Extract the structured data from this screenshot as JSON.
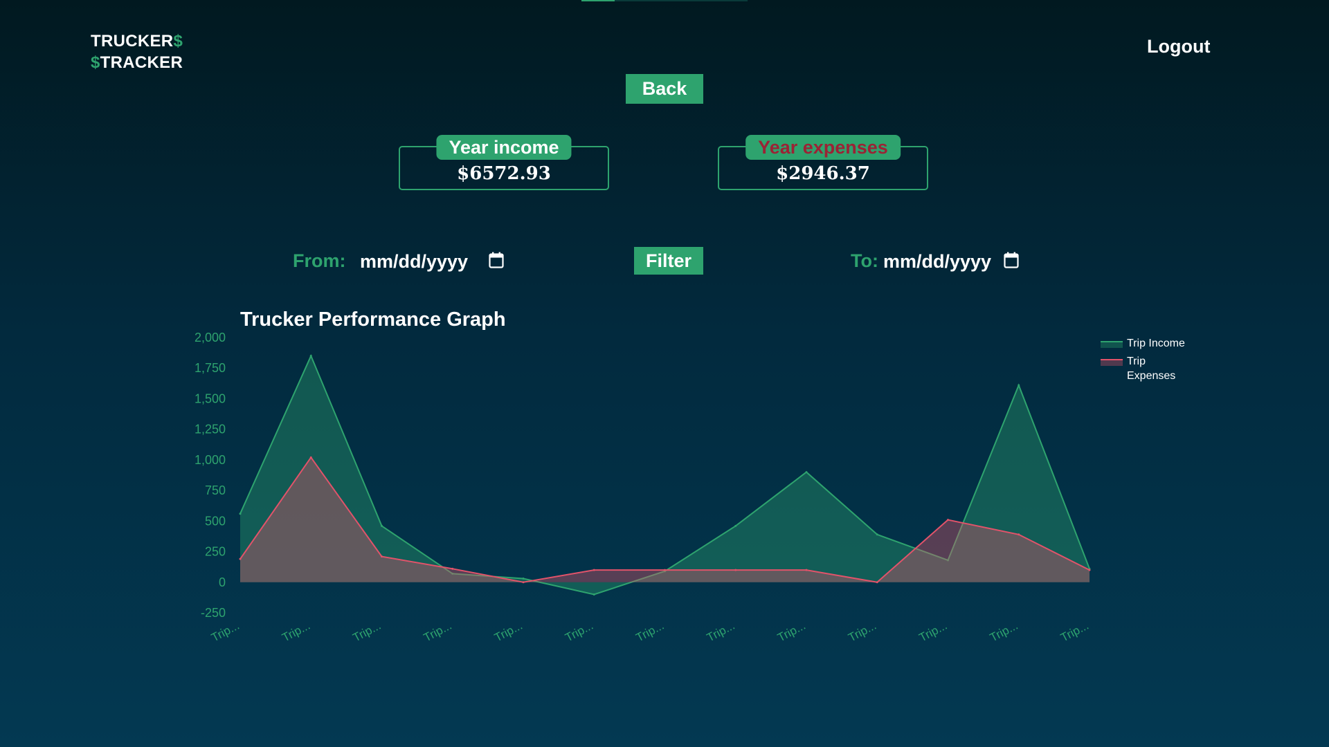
{
  "logo": {
    "line1_text": "TRUCKER",
    "line1_symbol": "$",
    "line2_symbol": "$",
    "line2_text": "TRACKER"
  },
  "header": {
    "logout_label": "Logout",
    "back_label": "Back"
  },
  "stats": {
    "income_label": "Year income",
    "income_value": "$6572.93",
    "expenses_label": "Year expenses",
    "expenses_value": "$2946.37"
  },
  "filter": {
    "from_label": "From:",
    "from_placeholder": "mm/dd/yyyy",
    "to_label": "To:",
    "to_placeholder": "mm/dd/yyyy",
    "button_label": "Filter"
  },
  "colors": {
    "accent": "#2ea36e",
    "expense_line": "#e2536a",
    "expense_label": "#9b2335"
  },
  "icons": {
    "date_picker": "calendar-icon"
  },
  "chart_data": {
    "type": "area",
    "title": "Trucker Performance Graph",
    "categories": [
      "Trip...",
      "Trip...",
      "Trip...",
      "Trip...",
      "Trip...",
      "Trip...",
      "Trip...",
      "Trip...",
      "Trip...",
      "Trip...",
      "Trip...",
      "Trip...",
      "Trip..."
    ],
    "series": [
      {
        "name": "Trip Income",
        "color": "#2ea36e",
        "values": [
          560,
          1850,
          460,
          70,
          30,
          -100,
          90,
          460,
          900,
          390,
          180,
          1610,
          110
        ]
      },
      {
        "name": "Trip Expenses",
        "color": "#e2536a",
        "values": [
          190,
          1020,
          210,
          110,
          0,
          100,
          100,
          100,
          100,
          0,
          510,
          390,
          100
        ]
      }
    ],
    "ylim": [
      -250,
      2000
    ],
    "yticks": [
      "2,000",
      "1,750",
      "1,500",
      "1,250",
      "1,000",
      "750",
      "500",
      "250",
      "0",
      "-250"
    ],
    "legend_position": "top-right",
    "grid": false
  }
}
